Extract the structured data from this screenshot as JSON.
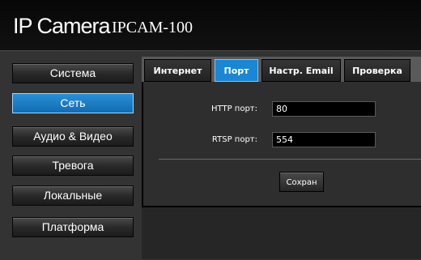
{
  "header": {
    "brand": "IP Camera",
    "model": "IPCAM-100"
  },
  "sidebar": {
    "items": [
      {
        "label": "Система",
        "active": false
      },
      {
        "label": "Сеть",
        "active": true
      },
      {
        "label": "Аудио & Видео",
        "active": false
      },
      {
        "label": "Тревога",
        "active": false
      },
      {
        "label": "Локальные",
        "active": false
      },
      {
        "label": "Платформа",
        "active": false
      }
    ]
  },
  "tabs": [
    {
      "label": "Интернет",
      "active": false
    },
    {
      "label": "Порт",
      "active": true
    },
    {
      "label": "Настр. Email",
      "active": false
    },
    {
      "label": "Проверка",
      "active": false
    }
  ],
  "form": {
    "http_label": "HTTP порт:",
    "http_value": "80",
    "rtsp_label": "RTSP порт:",
    "rtsp_value": "554",
    "save_label": "Сохран"
  },
  "colors": {
    "accent": "#1a86d4",
    "background": "#333333",
    "header": "#0a0a0a"
  }
}
